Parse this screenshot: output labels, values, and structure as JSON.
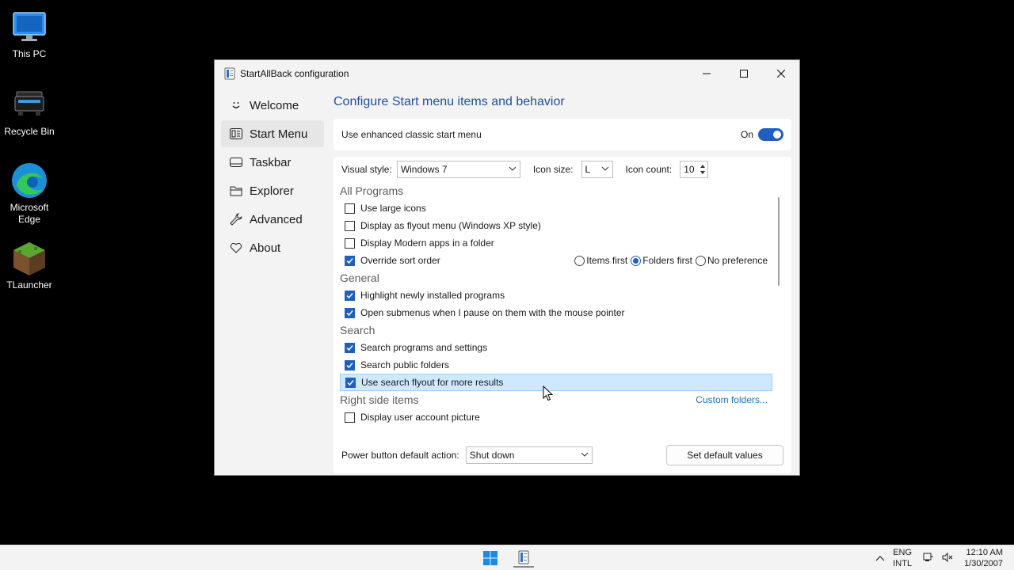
{
  "desktop": {
    "icons": [
      {
        "label": "This PC",
        "icon": "monitor-icon"
      },
      {
        "label": "Recycle Bin",
        "icon": "recycle-bin-icon"
      },
      {
        "label": "Microsoft Edge",
        "icon": "edge-icon"
      },
      {
        "label": "TLauncher",
        "icon": "tlauncher-icon"
      }
    ]
  },
  "window": {
    "title": "StartAllBack configuration",
    "sidebar": [
      {
        "label": "Welcome",
        "icon": "smile-icon"
      },
      {
        "label": "Start Menu",
        "icon": "start-menu-icon",
        "active": true
      },
      {
        "label": "Taskbar",
        "icon": "taskbar-icon"
      },
      {
        "label": "Explorer",
        "icon": "folder-icon"
      },
      {
        "label": "Advanced",
        "icon": "wrench-icon"
      },
      {
        "label": "About",
        "icon": "heart-icon"
      }
    ],
    "heading": "Configure Start menu items and behavior",
    "enhanced": {
      "label": "Use enhanced classic start menu",
      "state_label": "On",
      "on": true
    },
    "options": {
      "visual_style_label": "Visual style:",
      "visual_style_value": "Windows 7",
      "icon_size_label": "Icon size:",
      "icon_size_value": "L",
      "icon_count_label": "Icon count:",
      "icon_count_value": "10"
    },
    "sections": {
      "all_programs": "All Programs",
      "general": "General",
      "search": "Search",
      "right_side": "Right side items"
    },
    "items": {
      "large_icons": {
        "label": "Use large icons",
        "checked": false
      },
      "flyout": {
        "label": "Display as flyout menu (Windows XP style)",
        "checked": false
      },
      "modern_apps": {
        "label": "Display Modern apps in a folder",
        "checked": false
      },
      "override_sort": {
        "label": "Override sort order",
        "checked": true
      },
      "highlight_new": {
        "label": "Highlight newly installed programs",
        "checked": true
      },
      "open_submenus": {
        "label": "Open submenus when I pause on them with the mouse pointer",
        "checked": true
      },
      "search_programs": {
        "label": "Search programs and settings",
        "checked": true
      },
      "search_public": {
        "label": "Search public folders",
        "checked": true
      },
      "search_flyout": {
        "label": "Use search flyout for more results",
        "checked": true
      },
      "user_picture": {
        "label": "Display user account picture",
        "checked": false
      }
    },
    "sort_order": {
      "items_first": "Items first",
      "folders_first": "Folders first",
      "no_preference": "No preference",
      "selected": "folders_first"
    },
    "custom_folders_link": "Custom folders...",
    "power": {
      "label": "Power button default action:",
      "value": "Shut down"
    },
    "default_button": "Set default values"
  },
  "taskbar": {
    "lang_top": "ENG",
    "lang_bottom": "INTL",
    "time": "12:10 AM",
    "date": "1/30/2007"
  },
  "colors": {
    "accent": "#1f5fbf",
    "heading": "#1f4e9c",
    "link": "#1f6fc4",
    "highlight": "#cde8ff"
  }
}
